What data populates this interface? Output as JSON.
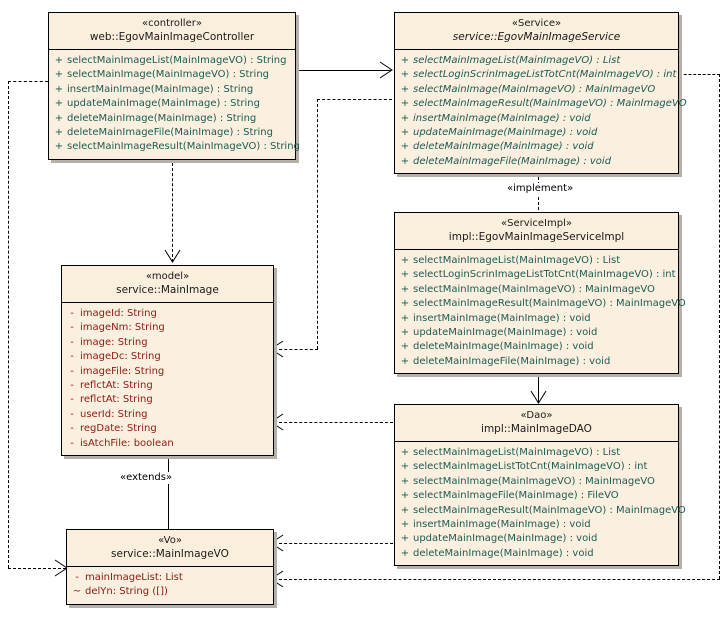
{
  "diagram": {
    "title": "MainImage UML class diagram",
    "colors": {
      "class_fill": "#fbefdf",
      "class_border": "#000000",
      "shadow": "#b5b0a8",
      "method_text": "#1a5c52",
      "attribute_text": "#8c1a12",
      "background": "#ffffff"
    }
  },
  "classes": {
    "controller": {
      "stereotype": "«controller»",
      "name": "web::EgovMainImageController",
      "members": [
        {
          "vis": "+",
          "sig": "selectMainImageList(MainImageVO) : String"
        },
        {
          "vis": "+",
          "sig": "selectMainImage(MainImageVO) : String"
        },
        {
          "vis": "+",
          "sig": "insertMainImage(MainImage) : String"
        },
        {
          "vis": "+",
          "sig": "updateMainImage(MainImage) : String"
        },
        {
          "vis": "+",
          "sig": "deleteMainImage(MainImage) : String"
        },
        {
          "vis": "+",
          "sig": "deleteMainImageFile(MainImage) : String"
        },
        {
          "vis": "+",
          "sig": "selectMainImageResult(MainImageVO) : String"
        }
      ]
    },
    "service": {
      "stereotype": "«Service»",
      "name": "service::EgovMainImageService",
      "members": [
        {
          "vis": "+",
          "sig": "selectMainImageList(MainImageVO) : List"
        },
        {
          "vis": "+",
          "sig": "selectLoginScrinImageListTotCnt(MainImageVO) : int"
        },
        {
          "vis": "+",
          "sig": "selectMainImage(MainImageVO) : MainImageVO"
        },
        {
          "vis": "+",
          "sig": "selectMainImageResult(MainImageVO) : MainImageVO"
        },
        {
          "vis": "+",
          "sig": "insertMainImage(MainImage) : void"
        },
        {
          "vis": "+",
          "sig": "updateMainImage(MainImage) : void"
        },
        {
          "vis": "+",
          "sig": "deleteMainImage(MainImage) : void"
        },
        {
          "vis": "+",
          "sig": "deleteMainImageFile(MainImage) : void"
        }
      ]
    },
    "service_impl": {
      "stereotype": "«ServiceImpl»",
      "name": "impl::EgovMainImageServiceImpl",
      "members": [
        {
          "vis": "+",
          "sig": "selectMainImageList(MainImageVO) : List"
        },
        {
          "vis": "+",
          "sig": "selectLoginScrinImageListTotCnt(MainImageVO) : int"
        },
        {
          "vis": "+",
          "sig": "selectMainImage(MainImageVO) : MainImageVO"
        },
        {
          "vis": "+",
          "sig": "selectMainImageResult(MainImageVO) : MainImageVO"
        },
        {
          "vis": "+",
          "sig": "insertMainImage(MainImage) : void"
        },
        {
          "vis": "+",
          "sig": "updateMainImage(MainImage) : void"
        },
        {
          "vis": "+",
          "sig": "deleteMainImage(MainImage) : void"
        },
        {
          "vis": "+",
          "sig": "deleteMainImageFile(MainImage) : void"
        }
      ]
    },
    "dao": {
      "stereotype": "«Dao»",
      "name": "impl::MainImageDAO",
      "members": [
        {
          "vis": "+",
          "sig": "selectMainImageList(MainImageVO) : List"
        },
        {
          "vis": "+",
          "sig": "selectMainImageListTotCnt(MainImageVO) : int"
        },
        {
          "vis": "+",
          "sig": "selectMainImage(MainImageVO) : MainImageVO"
        },
        {
          "vis": "+",
          "sig": "selectMainImageFile(MainImage) : FileVO"
        },
        {
          "vis": "+",
          "sig": "selectMainImageResult(MainImageVO) : MainImageVO"
        },
        {
          "vis": "+",
          "sig": "insertMainImage(MainImage) : void"
        },
        {
          "vis": "+",
          "sig": "updateMainImage(MainImage) : void"
        },
        {
          "vis": "+",
          "sig": "deleteMainImage(MainImage) : void"
        }
      ]
    },
    "model": {
      "stereotype": "«model»",
      "name": "service::MainImage",
      "members": [
        {
          "vis": "-",
          "sig": "imageId:  String"
        },
        {
          "vis": "-",
          "sig": "imageNm:  String"
        },
        {
          "vis": "-",
          "sig": "image:  String"
        },
        {
          "vis": "-",
          "sig": "imageDc:  String"
        },
        {
          "vis": "-",
          "sig": "imageFile:  String"
        },
        {
          "vis": "-",
          "sig": "reflctAt:  String"
        },
        {
          "vis": "-",
          "sig": "reflctAt:  String"
        },
        {
          "vis": "-",
          "sig": "userId:  String"
        },
        {
          "vis": "-",
          "sig": "regDate:  String"
        },
        {
          "vis": "-",
          "sig": "isAtchFile:  boolean"
        }
      ]
    },
    "vo": {
      "stereotype": "«Vo»",
      "name": "service::MainImageVO",
      "members": [
        {
          "vis": "-",
          "sig": "mainImageList:  List"
        },
        {
          "vis": "~",
          "sig": "delYn:  String ([])"
        }
      ]
    }
  },
  "relationships": {
    "implement_label": "«implement»",
    "extends_label": "«extends»"
  }
}
